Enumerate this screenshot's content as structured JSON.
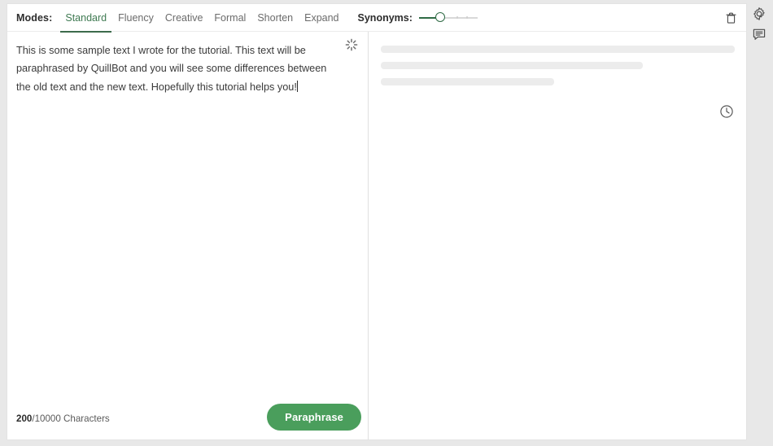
{
  "toolbar": {
    "modes_label": "Modes:",
    "modes": [
      {
        "label": "Standard",
        "active": true
      },
      {
        "label": "Fluency",
        "active": false
      },
      {
        "label": "Creative",
        "active": false
      },
      {
        "label": "Formal",
        "active": false
      },
      {
        "label": "Shorten",
        "active": false
      },
      {
        "label": "Expand",
        "active": false
      }
    ],
    "synonyms_label": "Synonyms:",
    "synonyms_value": 30,
    "trash_icon": "trash-icon"
  },
  "editor": {
    "text": "This is some sample text I wrote for the tutorial. This text will be paraphrased by QuillBot and you will see some differences between the old text and the new text. Hopefully this tutorial helps you!",
    "spinner_icon": "loading-spinner-icon",
    "caret_visible": true
  },
  "footer": {
    "char_used": "200",
    "char_limit_text": "/10000 Characters",
    "paraphrase_label": "Paraphrase",
    "history_icon": "clock-history-icon"
  },
  "output": {
    "loading": true,
    "skeleton_widths": [
      "100%",
      "74%",
      "50%"
    ]
  },
  "rail": {
    "items": [
      {
        "icon": "gear-icon",
        "name": "settings"
      },
      {
        "icon": "feedback-comment-icon",
        "name": "feedback"
      }
    ]
  },
  "colors": {
    "accent_green": "#4a9e5c",
    "tab_active": "#3f7a52",
    "underline": "#3d6b4c",
    "skeleton": "#ececec",
    "page_bg": "#e8e8e8"
  }
}
